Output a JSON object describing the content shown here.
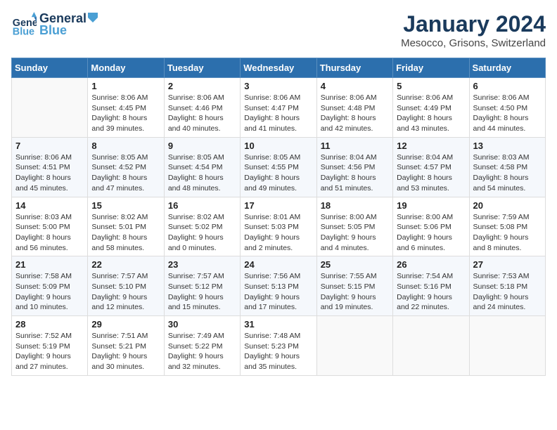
{
  "logo": {
    "line1": "General",
    "line2": "Blue"
  },
  "title": "January 2024",
  "subtitle": "Mesocco, Grisons, Switzerland",
  "days_of_week": [
    "Sunday",
    "Monday",
    "Tuesday",
    "Wednesday",
    "Thursday",
    "Friday",
    "Saturday"
  ],
  "weeks": [
    [
      {
        "day": "",
        "info": ""
      },
      {
        "day": "1",
        "info": "Sunrise: 8:06 AM\nSunset: 4:45 PM\nDaylight: 8 hours\nand 39 minutes."
      },
      {
        "day": "2",
        "info": "Sunrise: 8:06 AM\nSunset: 4:46 PM\nDaylight: 8 hours\nand 40 minutes."
      },
      {
        "day": "3",
        "info": "Sunrise: 8:06 AM\nSunset: 4:47 PM\nDaylight: 8 hours\nand 41 minutes."
      },
      {
        "day": "4",
        "info": "Sunrise: 8:06 AM\nSunset: 4:48 PM\nDaylight: 8 hours\nand 42 minutes."
      },
      {
        "day": "5",
        "info": "Sunrise: 8:06 AM\nSunset: 4:49 PM\nDaylight: 8 hours\nand 43 minutes."
      },
      {
        "day": "6",
        "info": "Sunrise: 8:06 AM\nSunset: 4:50 PM\nDaylight: 8 hours\nand 44 minutes."
      }
    ],
    [
      {
        "day": "7",
        "info": "Sunrise: 8:06 AM\nSunset: 4:51 PM\nDaylight: 8 hours\nand 45 minutes."
      },
      {
        "day": "8",
        "info": "Sunrise: 8:05 AM\nSunset: 4:52 PM\nDaylight: 8 hours\nand 47 minutes."
      },
      {
        "day": "9",
        "info": "Sunrise: 8:05 AM\nSunset: 4:54 PM\nDaylight: 8 hours\nand 48 minutes."
      },
      {
        "day": "10",
        "info": "Sunrise: 8:05 AM\nSunset: 4:55 PM\nDaylight: 8 hours\nand 49 minutes."
      },
      {
        "day": "11",
        "info": "Sunrise: 8:04 AM\nSunset: 4:56 PM\nDaylight: 8 hours\nand 51 minutes."
      },
      {
        "day": "12",
        "info": "Sunrise: 8:04 AM\nSunset: 4:57 PM\nDaylight: 8 hours\nand 53 minutes."
      },
      {
        "day": "13",
        "info": "Sunrise: 8:03 AM\nSunset: 4:58 PM\nDaylight: 8 hours\nand 54 minutes."
      }
    ],
    [
      {
        "day": "14",
        "info": "Sunrise: 8:03 AM\nSunset: 5:00 PM\nDaylight: 8 hours\nand 56 minutes."
      },
      {
        "day": "15",
        "info": "Sunrise: 8:02 AM\nSunset: 5:01 PM\nDaylight: 8 hours\nand 58 minutes."
      },
      {
        "day": "16",
        "info": "Sunrise: 8:02 AM\nSunset: 5:02 PM\nDaylight: 9 hours\nand 0 minutes."
      },
      {
        "day": "17",
        "info": "Sunrise: 8:01 AM\nSunset: 5:03 PM\nDaylight: 9 hours\nand 2 minutes."
      },
      {
        "day": "18",
        "info": "Sunrise: 8:00 AM\nSunset: 5:05 PM\nDaylight: 9 hours\nand 4 minutes."
      },
      {
        "day": "19",
        "info": "Sunrise: 8:00 AM\nSunset: 5:06 PM\nDaylight: 9 hours\nand 6 minutes."
      },
      {
        "day": "20",
        "info": "Sunrise: 7:59 AM\nSunset: 5:08 PM\nDaylight: 9 hours\nand 8 minutes."
      }
    ],
    [
      {
        "day": "21",
        "info": "Sunrise: 7:58 AM\nSunset: 5:09 PM\nDaylight: 9 hours\nand 10 minutes."
      },
      {
        "day": "22",
        "info": "Sunrise: 7:57 AM\nSunset: 5:10 PM\nDaylight: 9 hours\nand 12 minutes."
      },
      {
        "day": "23",
        "info": "Sunrise: 7:57 AM\nSunset: 5:12 PM\nDaylight: 9 hours\nand 15 minutes."
      },
      {
        "day": "24",
        "info": "Sunrise: 7:56 AM\nSunset: 5:13 PM\nDaylight: 9 hours\nand 17 minutes."
      },
      {
        "day": "25",
        "info": "Sunrise: 7:55 AM\nSunset: 5:15 PM\nDaylight: 9 hours\nand 19 minutes."
      },
      {
        "day": "26",
        "info": "Sunrise: 7:54 AM\nSunset: 5:16 PM\nDaylight: 9 hours\nand 22 minutes."
      },
      {
        "day": "27",
        "info": "Sunrise: 7:53 AM\nSunset: 5:18 PM\nDaylight: 9 hours\nand 24 minutes."
      }
    ],
    [
      {
        "day": "28",
        "info": "Sunrise: 7:52 AM\nSunset: 5:19 PM\nDaylight: 9 hours\nand 27 minutes."
      },
      {
        "day": "29",
        "info": "Sunrise: 7:51 AM\nSunset: 5:21 PM\nDaylight: 9 hours\nand 30 minutes."
      },
      {
        "day": "30",
        "info": "Sunrise: 7:49 AM\nSunset: 5:22 PM\nDaylight: 9 hours\nand 32 minutes."
      },
      {
        "day": "31",
        "info": "Sunrise: 7:48 AM\nSunset: 5:23 PM\nDaylight: 9 hours\nand 35 minutes."
      },
      {
        "day": "",
        "info": ""
      },
      {
        "day": "",
        "info": ""
      },
      {
        "day": "",
        "info": ""
      }
    ]
  ]
}
